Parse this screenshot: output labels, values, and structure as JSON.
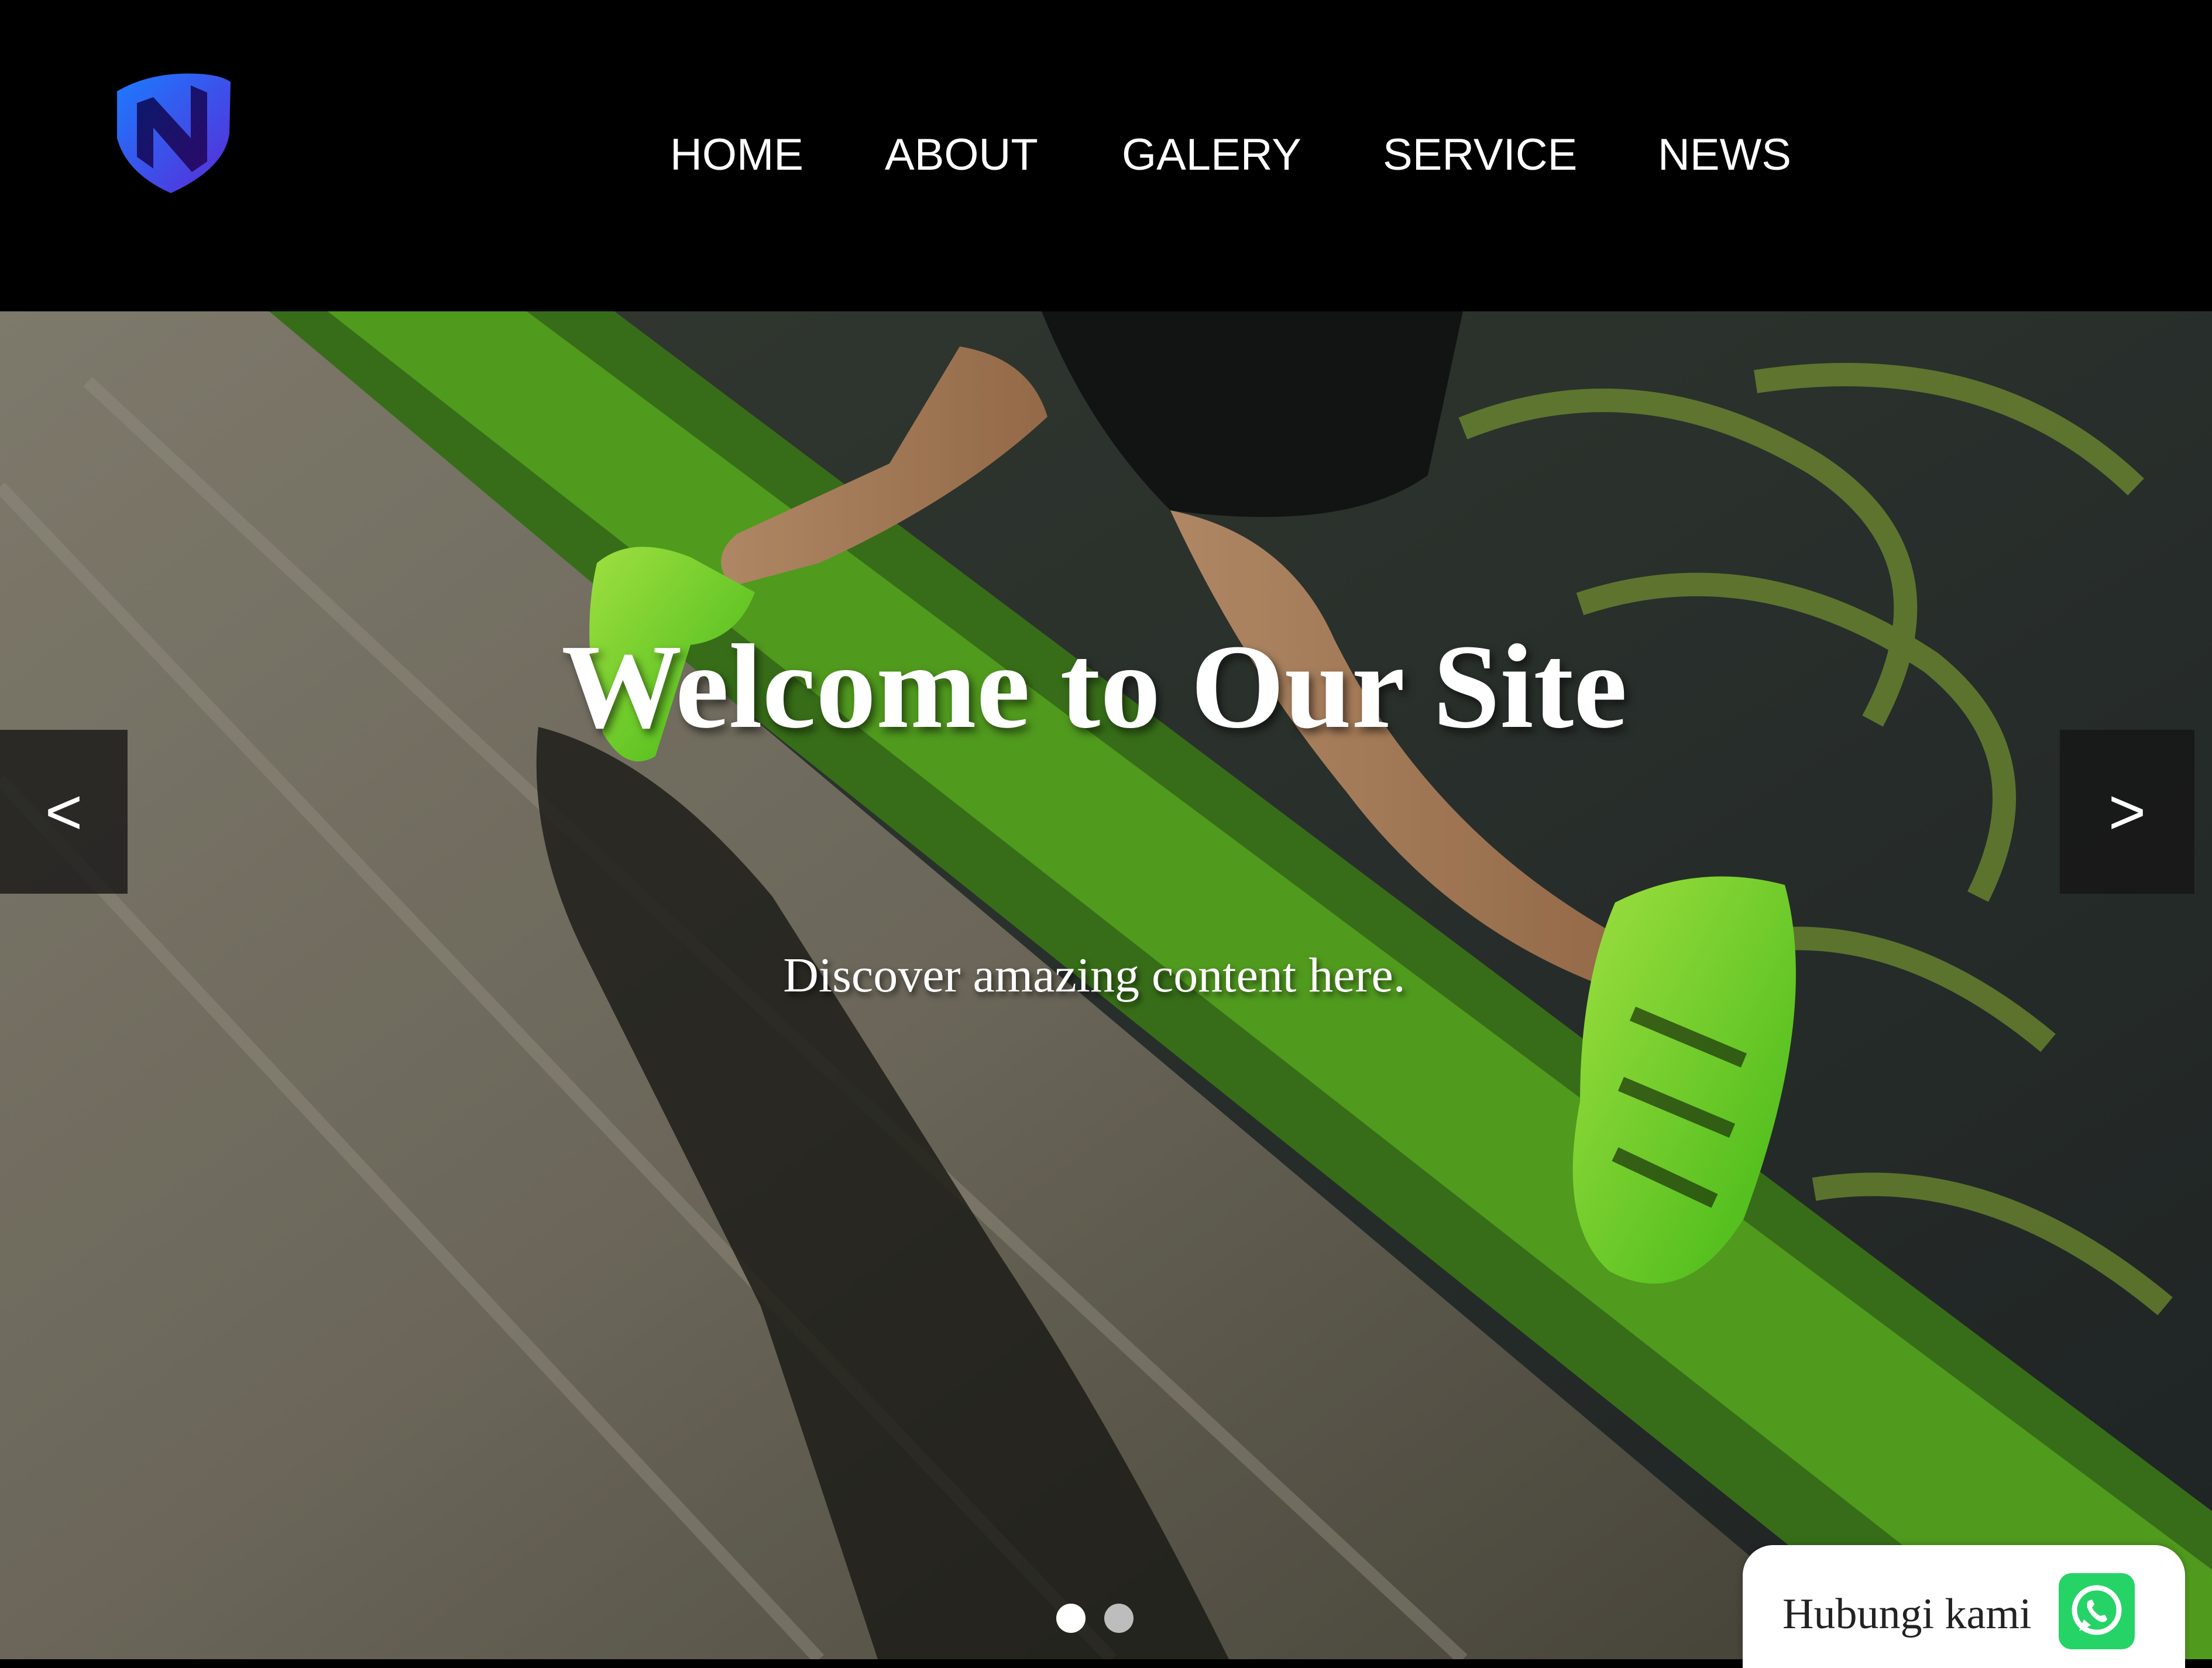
{
  "header": {
    "logo_icon": "shield-n-logo-icon",
    "nav": [
      "HOME",
      "ABOUT",
      "GALERY",
      "SERVICE",
      "NEWS"
    ]
  },
  "hero": {
    "background": "runner-in-green-shoes-photo",
    "title": "Welcome to Our Site",
    "subtitle": "Discover amazing content here.",
    "prev_label": "<",
    "next_label": ">",
    "slide_count": 2,
    "active_slide": 1
  },
  "contact": {
    "label": "Hubungi kami",
    "icon": "whatsapp-icon",
    "color": "#25d366"
  },
  "colors": {
    "header_bg": "#000000",
    "accent_green": "#7cfc2a"
  }
}
